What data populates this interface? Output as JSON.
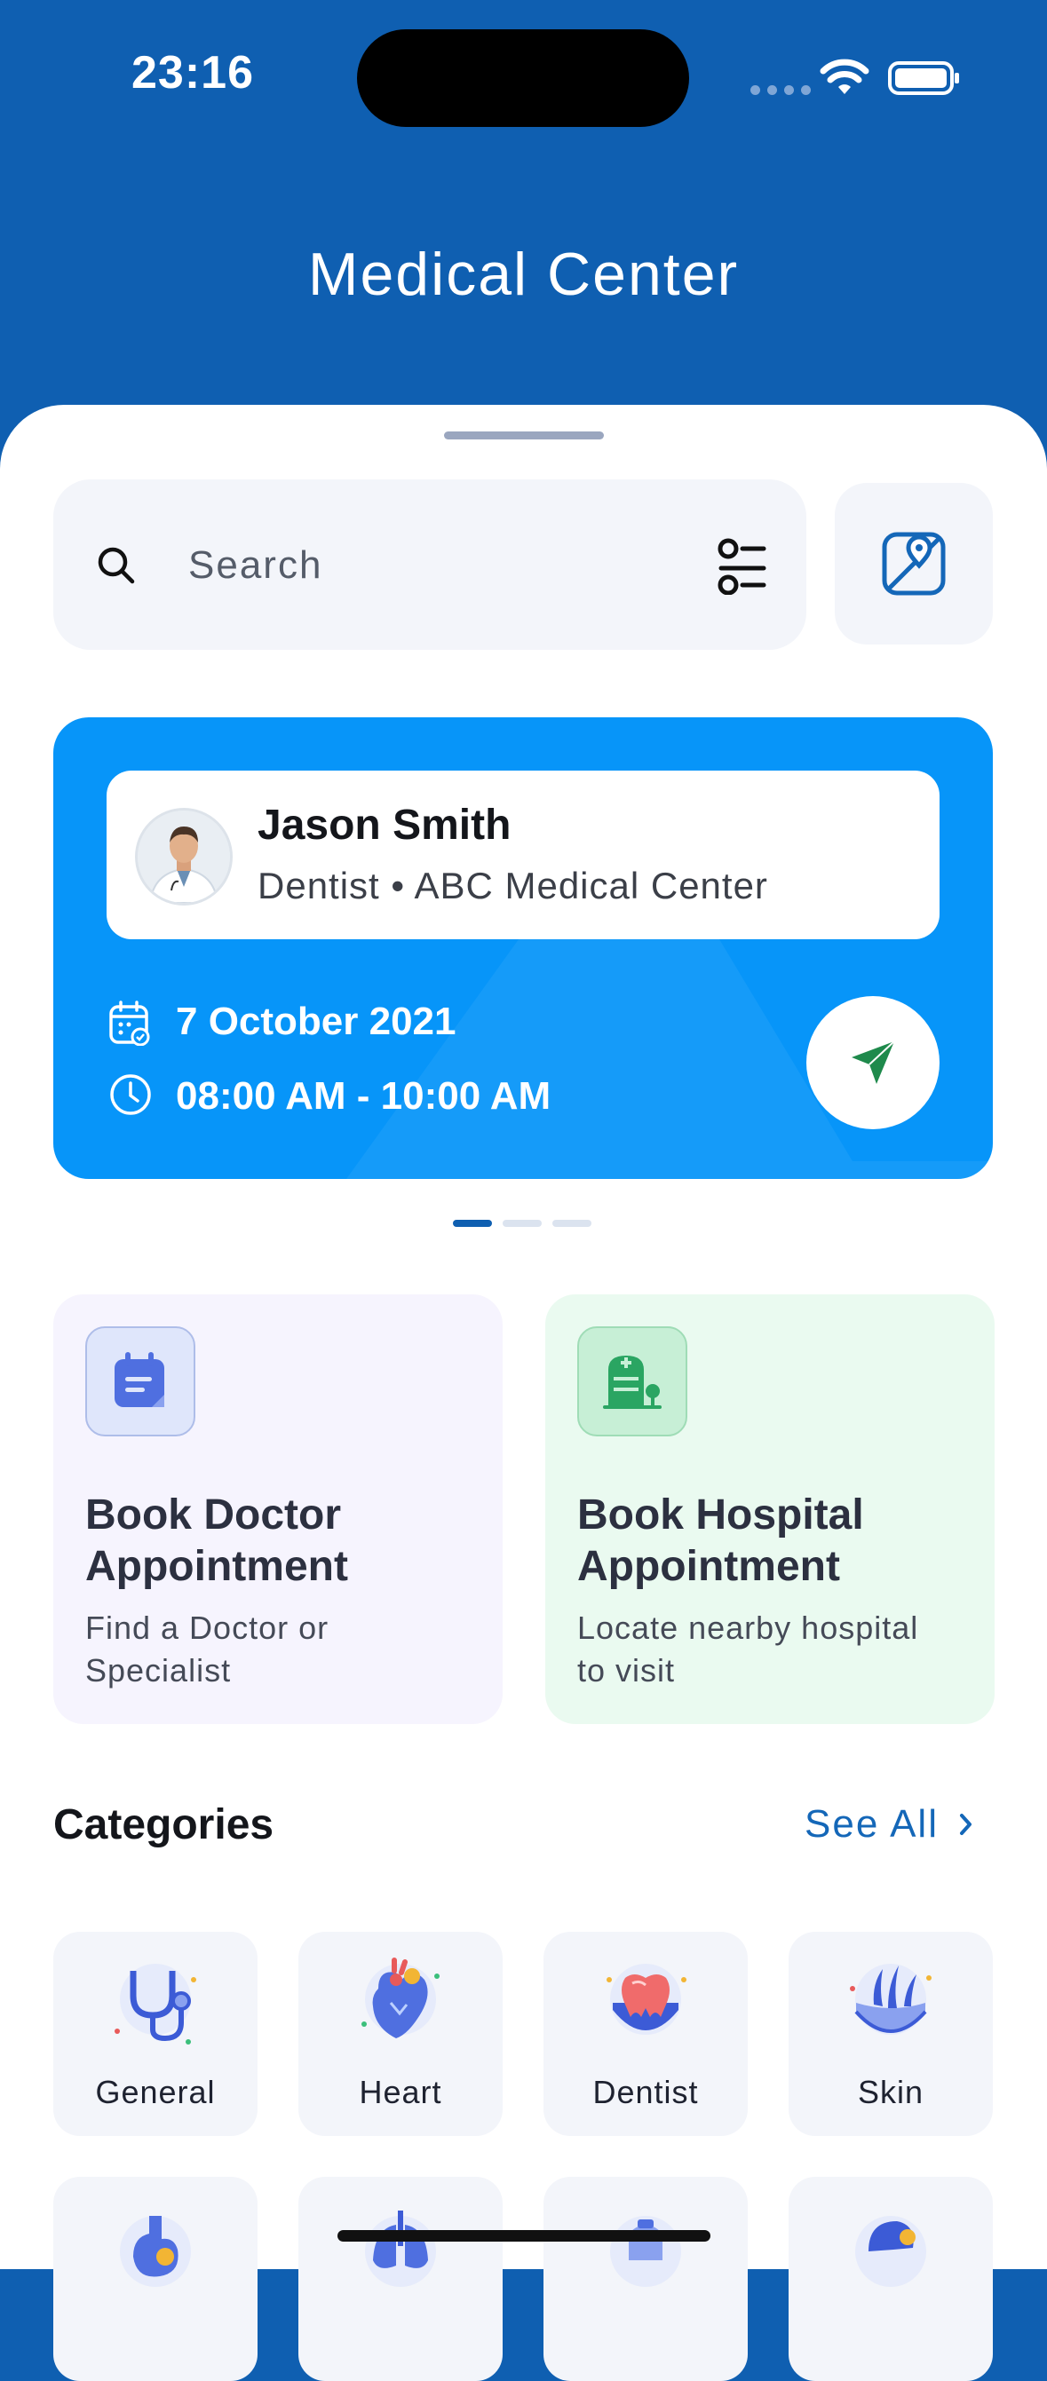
{
  "status_bar": {
    "time": "23:16"
  },
  "header": {
    "title": "Medical Center"
  },
  "search": {
    "placeholder": "Search"
  },
  "appointment": {
    "doctor_name": "Jason Smith",
    "doctor_subtitle": "Dentist • ABC Medical Center",
    "date": "7 October 2021",
    "time_range": "08:00 AM - 10:00 AM",
    "carousel_pages": 3,
    "carousel_active_index": 0
  },
  "booking": [
    {
      "title_line1": "Book Doctor",
      "title_line2": "Appointment",
      "sub_line1": "Find a Doctor or",
      "sub_line2": "Specialist"
    },
    {
      "title_line1": "Book Hospital",
      "title_line2": "Appointment",
      "sub_line1": "Locate nearby hospital",
      "sub_line2": "to visit"
    }
  ],
  "categories": {
    "title": "Categories",
    "see_all": "See All",
    "items": [
      {
        "label": "General",
        "icon": "stethoscope-icon"
      },
      {
        "label": "Heart",
        "icon": "heart-icon"
      },
      {
        "label": "Dentist",
        "icon": "tooth-icon"
      },
      {
        "label": "Skin",
        "icon": "skin-icon"
      }
    ]
  },
  "colors": {
    "header_bg": "#0f5fb1",
    "card_blue": "#0795f9",
    "doctor_card_bg": "#f6f4fe",
    "hospital_card_bg": "#eafaf0",
    "accent_green": "#1f8a4c",
    "link_blue": "#1467b8"
  }
}
